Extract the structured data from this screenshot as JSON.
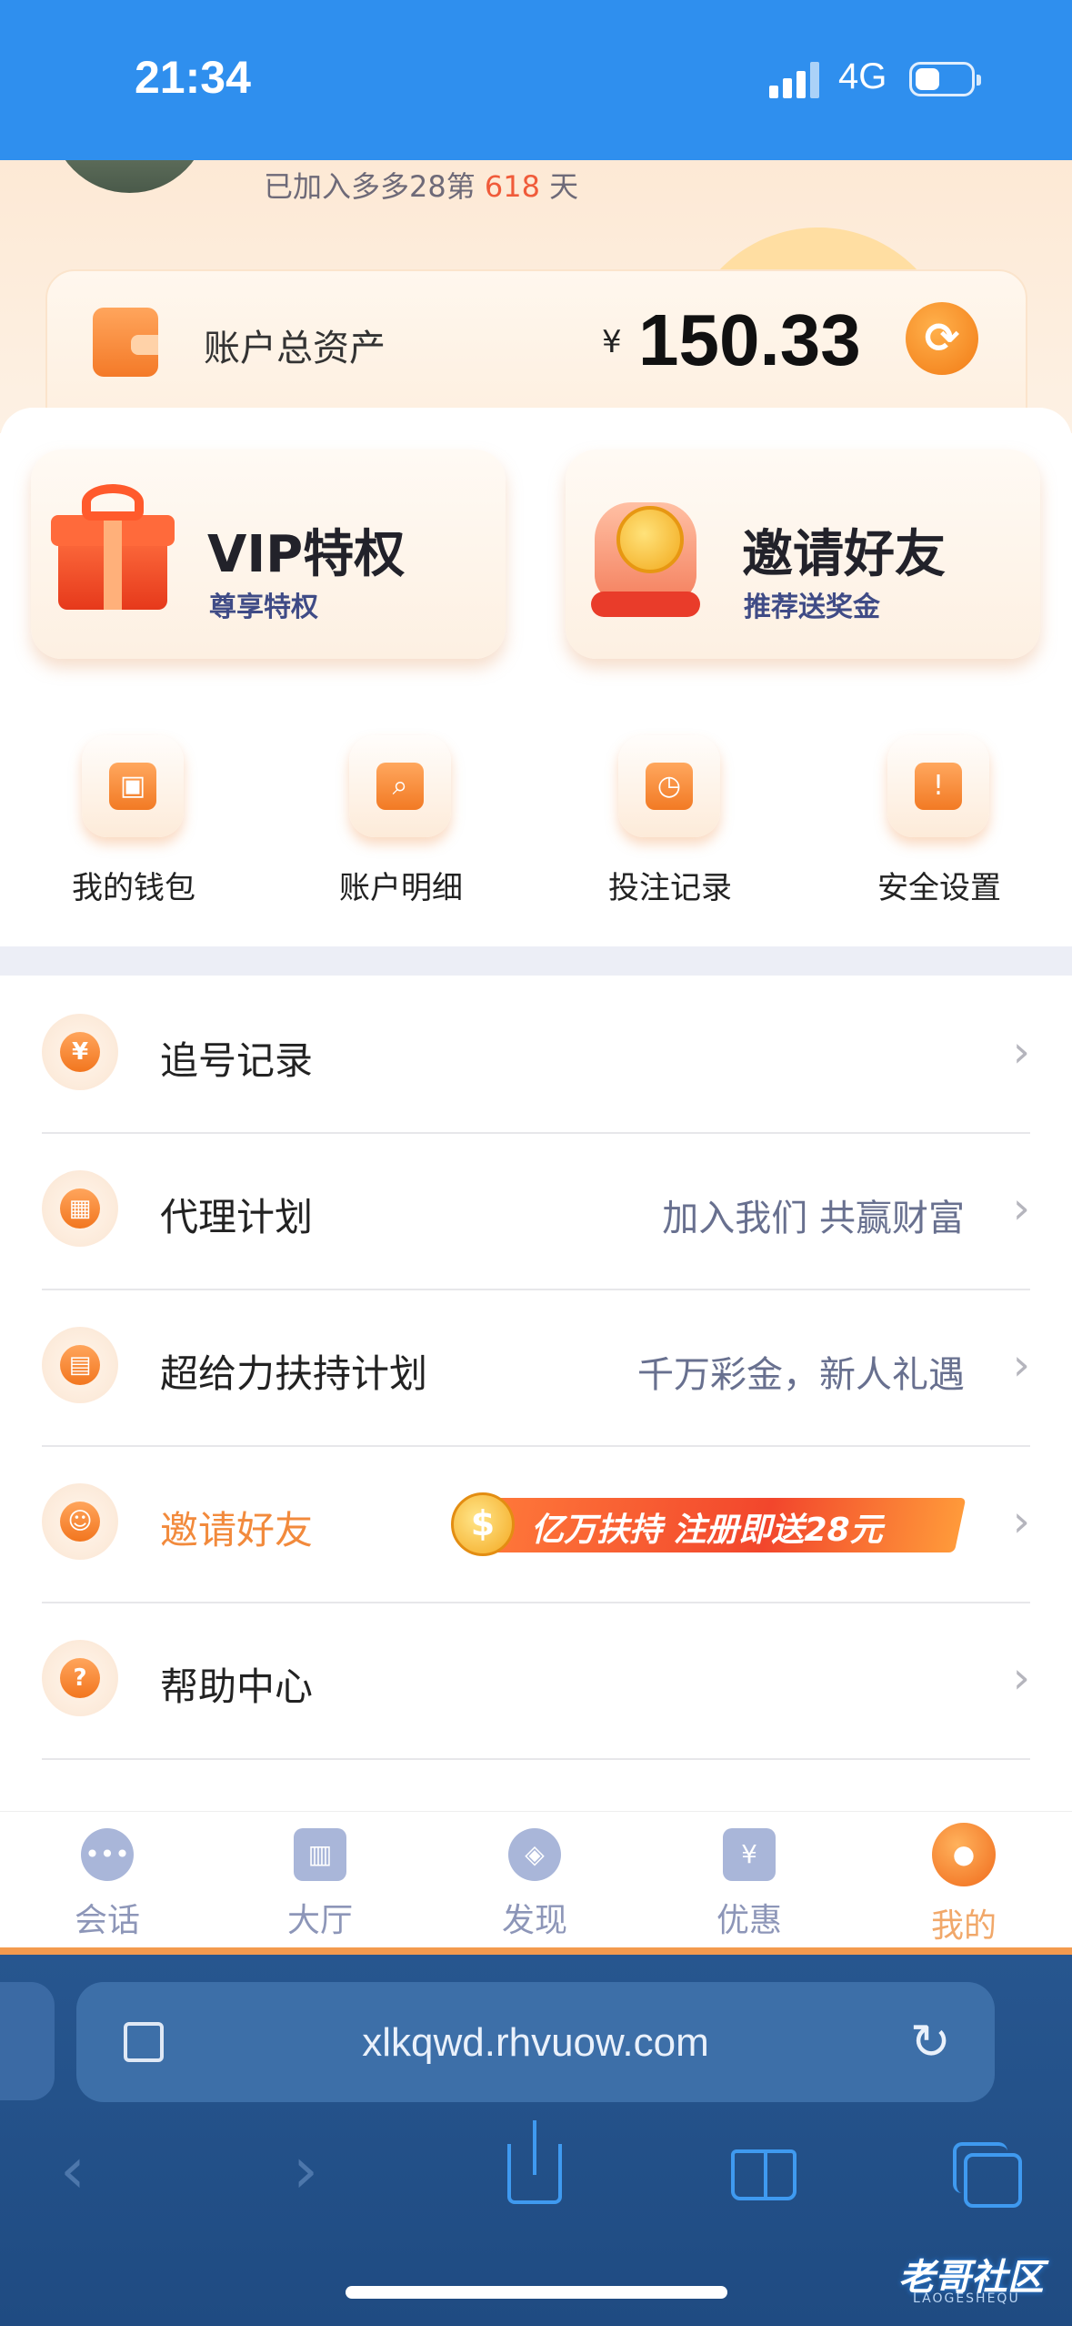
{
  "status": {
    "time": "21:34",
    "network": "4G",
    "battery_level": 0.45
  },
  "profile": {
    "joined_prefix": "已加入多多28第 ",
    "joined_days": "618",
    "joined_suffix": " 天"
  },
  "assets": {
    "label": "账户总资产",
    "currency": "¥",
    "value": "150.33"
  },
  "features": [
    {
      "title": "VIP特权",
      "subtitle": "尊享特权"
    },
    {
      "title": "邀请好友",
      "subtitle": "推荐送奖金"
    }
  ],
  "quick_actions": [
    {
      "label": "我的钱包",
      "icon": "wallet-icon"
    },
    {
      "label": "账户明细",
      "icon": "statement-search-icon"
    },
    {
      "label": "投注记录",
      "icon": "bet-record-icon"
    },
    {
      "label": "安全设置",
      "icon": "shield-icon"
    }
  ],
  "menu": [
    {
      "label": "追号记录",
      "extra": "",
      "icon": "yen-tag-icon"
    },
    {
      "label": "代理计划",
      "extra": "加入我们 共赢财富",
      "icon": "qr-code-icon"
    },
    {
      "label": "超给力扶持计划",
      "extra": "千万彩金，新人礼遇",
      "icon": "gift-icon"
    },
    {
      "label": "邀请好友",
      "extra": "",
      "icon": "user-icon",
      "promo": "亿万扶持  注册即送28元"
    },
    {
      "label": "帮助中心",
      "extra": "",
      "icon": "help-icon"
    }
  ],
  "tabs": [
    {
      "label": "会话",
      "icon": "chat-icon",
      "active": false
    },
    {
      "label": "大厅",
      "icon": "bank-icon",
      "active": false
    },
    {
      "label": "发现",
      "icon": "compass-icon",
      "active": false
    },
    {
      "label": "优惠",
      "icon": "coupon-icon",
      "active": false
    },
    {
      "label": "我的",
      "icon": "profile-icon",
      "active": true
    }
  ],
  "browser": {
    "url": "xlkqwd.rhvuow.com"
  },
  "watermark": {
    "text": "老哥社区",
    "sub": "LAOGESHEQU"
  },
  "colors": {
    "status_bar": "#2f8fee",
    "accent": "#f27a24",
    "browser_bg": "#1f4b82"
  }
}
